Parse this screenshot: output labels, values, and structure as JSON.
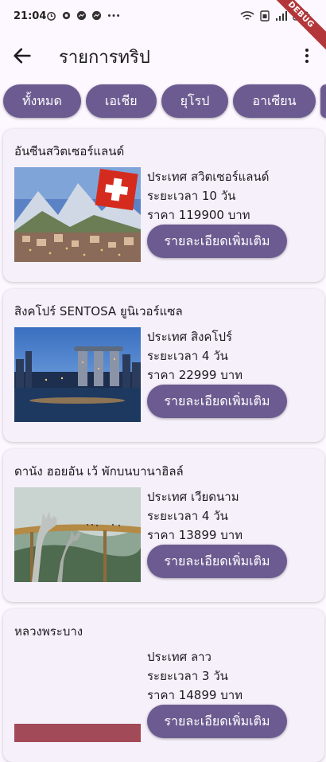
{
  "status_bar": {
    "time": "21:04",
    "debug_label": "DEBUG"
  },
  "app_bar": {
    "title": "รายการทริป",
    "back_icon": "arrow-left-icon",
    "menu_icon": "more-vertical-icon"
  },
  "filters": [
    {
      "label": "ทั้งหมด"
    },
    {
      "label": "เอเชีย"
    },
    {
      "label": "ยุโรป"
    },
    {
      "label": "อาเซียน"
    }
  ],
  "trips": [
    {
      "name": "อันซีนสวิตเซอร์แลนด์",
      "country": "ประเทศ สวิตเซอร์แลนด์",
      "duration": "ระยะเวลา 10 วัน",
      "price": "ราคา 119900 บาท",
      "button": "รายละเอียดเพิ่มเติม"
    },
    {
      "name": "สิงคโปร์ SENTOSA ยูนิเวอร์แซล",
      "country": "ประเทศ สิงคโปร์",
      "duration": "ระยะเวลา 4 วัน",
      "price": "ราคา 22999 บาท",
      "button": "รายละเอียดเพิ่มเติม"
    },
    {
      "name": "ดานัง ฮอยอัน เว้ พักบนบานาฮิลล์",
      "country": "ประเทศ เวียดนาม",
      "duration": "ระยะเวลา 4 วัน",
      "price": "ราคา 13899 บาท",
      "button": "รายละเอียดเพิ่มเติม"
    },
    {
      "name": "หลวงพระบาง",
      "country": "ประเทศ ลาว",
      "duration": "ระยะเวลา 3 วัน",
      "price": "ราคา 14899 บาท",
      "button": "รายละเอียดเพิ่มเติม"
    }
  ],
  "colors": {
    "accent": "#6c5b91",
    "background": "#fdf7ff",
    "card": "#f6f0fa",
    "debug_banner": "#b3373a"
  }
}
